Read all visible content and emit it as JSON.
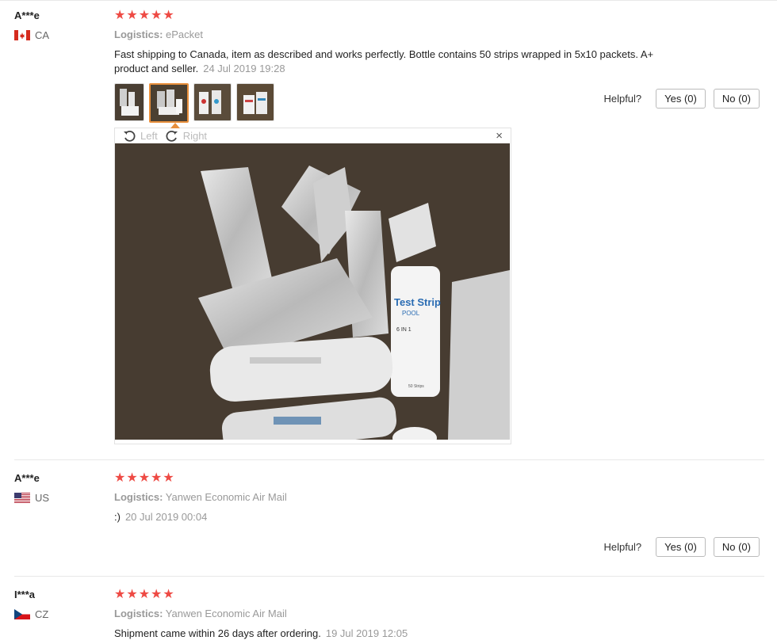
{
  "labels": {
    "logistics": "Logistics:",
    "helpful": "Helpful?",
    "viewer_left": "Left",
    "viewer_right": "Right",
    "close": "×"
  },
  "reviews": [
    {
      "user": "A***e",
      "country": "CA",
      "stars": "★★★★★",
      "logistics": "ePacket",
      "text": "Fast shipping to Canada, item as described and works perfectly. Bottle contains 50 strips wrapped in 5x10 packets. A+ product and seller.",
      "date": "24 Jul 2019 19:28",
      "yes": "Yes (0)",
      "no": "No (0)"
    },
    {
      "user": "A***e",
      "country": "US",
      "stars": "★★★★★",
      "logistics": "Yanwen Economic Air Mail",
      "text": ":)",
      "date": "20 Jul 2019 00:04",
      "yes": "Yes (0)",
      "no": "No (0)"
    },
    {
      "user": "I***a",
      "country": "CZ",
      "stars": "★★★★★",
      "logistics": "Yanwen Economic Air Mail",
      "text": "Shipment came within 26 days after ordering.",
      "date": "19 Jul 2019 12:05"
    }
  ],
  "photo": {
    "label_brand": "Test Strip",
    "label_sub": "POOL",
    "label_type": "6 IN 1",
    "label_count": "50 Strips"
  },
  "colors": {
    "star": "#ee4a44",
    "accent": "#e88f3c"
  }
}
